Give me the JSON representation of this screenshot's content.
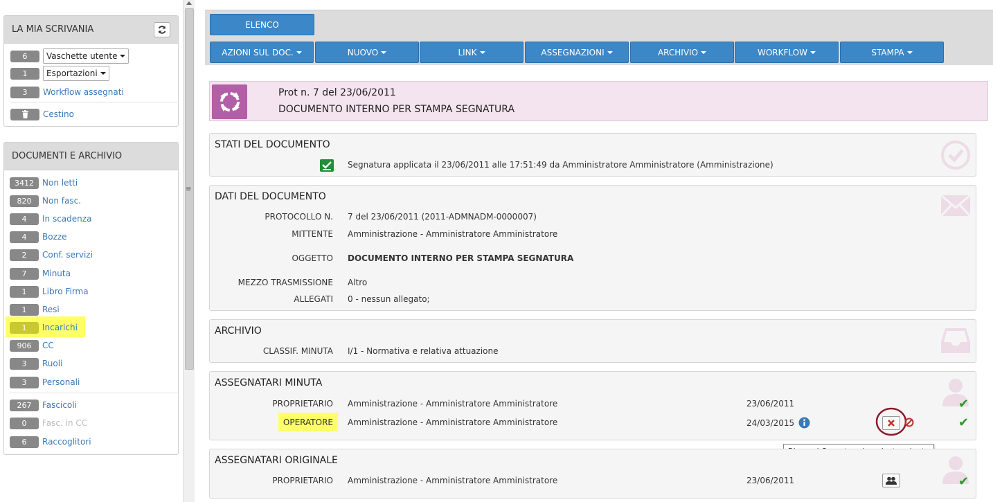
{
  "sidebar": {
    "desk": {
      "title": "LA MIA SCRIVANIA",
      "items": [
        {
          "count": "6",
          "label": "Vaschette utente"
        },
        {
          "count": "1",
          "label": "Esportazioni"
        },
        {
          "count": "3",
          "label": "Workflow assegnati"
        }
      ],
      "trash_label": "Cestino"
    },
    "archive": {
      "title": "DOCUMENTI E ARCHIVIO",
      "items": [
        {
          "count": "3412",
          "label": "Non letti"
        },
        {
          "count": "820",
          "label": "Non fasc."
        },
        {
          "count": "4",
          "label": "In scadenza"
        },
        {
          "count": "4",
          "label": "Bozze"
        },
        {
          "count": "2",
          "label": "Conf. servizi"
        },
        {
          "count": "7",
          "label": "Minuta"
        },
        {
          "count": "1",
          "label": "Libro Firma"
        },
        {
          "count": "1",
          "label": "Resi"
        },
        {
          "count": "1",
          "label": "Incarichi"
        },
        {
          "count": "906",
          "label": "CC"
        },
        {
          "count": "3",
          "label": "Ruoli"
        },
        {
          "count": "3",
          "label": "Personali"
        },
        {
          "count": "267",
          "label": "Fascicoli"
        },
        {
          "count": "0",
          "label": "Fasc. in CC"
        },
        {
          "count": "6",
          "label": "Raccoglitori"
        }
      ]
    }
  },
  "toolbar": {
    "list_label": "ELENCO",
    "menus": [
      "AZIONI SUL DOC.",
      "NUOVO",
      "LINK",
      "ASSEGNAZIONI",
      "ARCHIVIO",
      "WORKFLOW",
      "STAMPA"
    ]
  },
  "header": {
    "line1": "Prot n. 7 del 23/06/2011",
    "line2": "DOCUMENTO INTERNO PER STAMPA SEGNATURA"
  },
  "states": {
    "title": "STATI DEL DOCUMENTO",
    "text": "Segnatura applicata il 23/06/2011 alle 17:51:49 da Amministratore Amministratore (Amministrazione)"
  },
  "doc_data": {
    "title": "DATI DEL DOCUMENTO",
    "protocol_label": "PROTOCOLLO N.",
    "protocol_value": "7 del 23/06/2011 (2011-ADMNADM-0000007)",
    "sender_label": "MITTENTE",
    "sender_value": "Amministrazione - Amministratore Amministratore",
    "subject_label": "OGGETTO",
    "subject_value": "DOCUMENTO INTERNO PER STAMPA SEGNATURA",
    "means_label": "MEZZO TRASMISSIONE",
    "means_value": "Altro",
    "attach_label": "ALLEGATI",
    "attach_value": "0 - nessun allegato;"
  },
  "archive_section": {
    "title": "ARCHIVIO",
    "class_label": "CLASSIF. MINUTA",
    "class_value": "I/1 - Normativa e relativa attuazione"
  },
  "assign_minuta": {
    "title": "ASSEGNATARI MINUTA",
    "owner_label": "PROPRIETARIO",
    "owner_value": "Amministrazione - Amministratore Amministratore",
    "owner_date": "23/06/2011",
    "operator_label": "OPERATORE",
    "operator_value": "Amministrazione - Amministratore Amministratore",
    "operator_date": "24/03/2015"
  },
  "tooltip": "Rimuovi Operatore incaricato minuta",
  "assign_original": {
    "title": "ASSEGNATARI ORIGINALE",
    "owner_label": "PROPRIETARIO",
    "owner_value": "Amministrazione - Amministratore Amministratore",
    "owner_date": "23/06/2011"
  },
  "colors": {
    "toolbar_blue": "#3c87c8",
    "header_pink": "#f4e4ef",
    "header_icon": "#b25fa8",
    "highlight": "#ffff66",
    "check_green": "#2a9a2a"
  }
}
